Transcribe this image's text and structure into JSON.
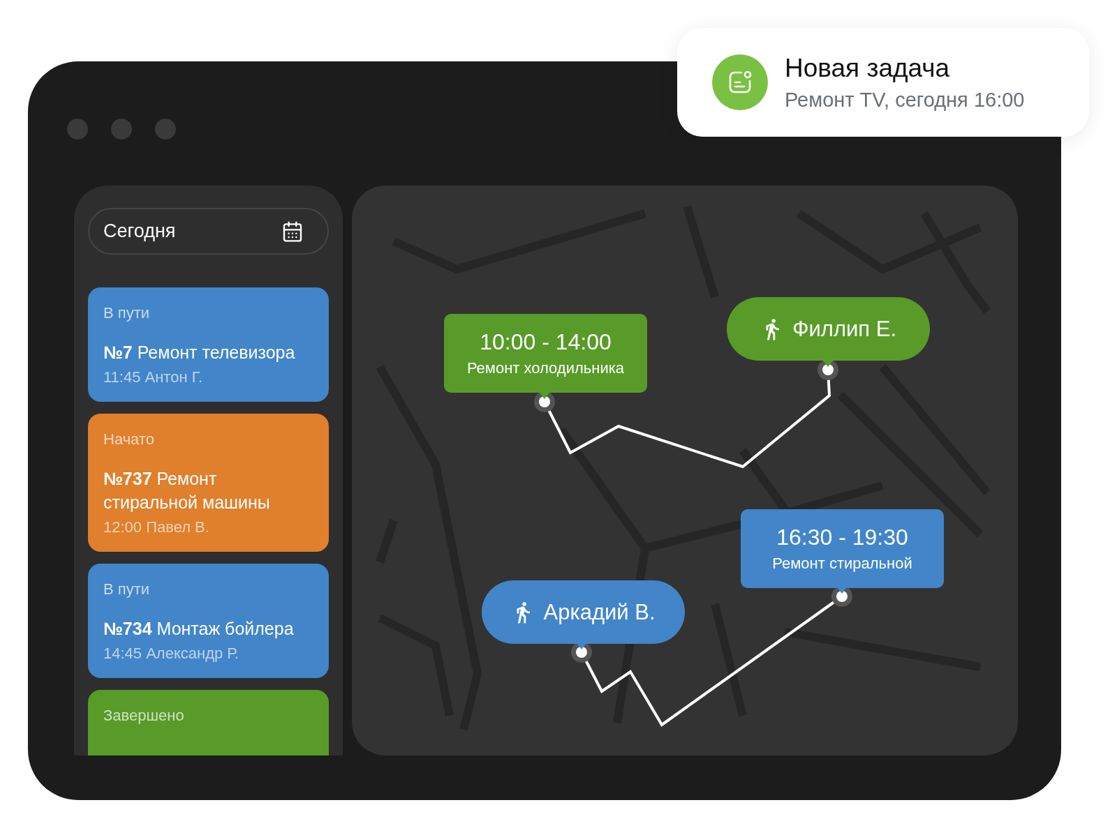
{
  "notification": {
    "title": "Новая задача",
    "subtitle": "Ремонт TV, сегодня 16:00"
  },
  "date_picker": {
    "value": "Сегодня"
  },
  "tasks": [
    {
      "status": "В пути",
      "title": "**№7** Ремонт телевизора",
      "details": "11:45 Антон Г.",
      "color": "#4285c9"
    },
    {
      "status": "Начато",
      "title": "**№737** Ремонт стиральной машины",
      "details": "12:00 Павел В.",
      "color": "#e07f2c"
    },
    {
      "status": "В пути",
      "title": "**№734** Монтаж бойлера",
      "details": "14:45 Александр  Р.",
      "color": "#4285c9"
    },
    {
      "status": "Завершено",
      "color": "#589b29"
    }
  ],
  "map_markers": [
    {
      "kind": "slot",
      "time": "10:00 - 14:00",
      "label": "Ремонт холодильника",
      "color": "#589b29"
    },
    {
      "kind": "person",
      "name": "Филлип Е.",
      "color": "#589b29"
    },
    {
      "kind": "slot",
      "time": "16:30 - 19:30",
      "label": "Ремонт стиральной",
      "color": "#4285c9"
    },
    {
      "kind": "person",
      "name": "Аркадий В.",
      "color": "#4285c9"
    }
  ]
}
